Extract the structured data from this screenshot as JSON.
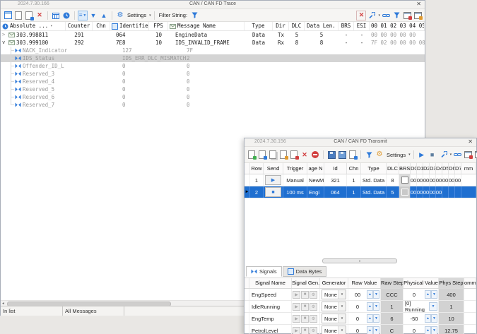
{
  "colors": {
    "accent": "#2f7ad9",
    "selection_blue": "#1f6fd0",
    "danger_red": "#d23f3f",
    "selected_gray": "#d4d4d4"
  },
  "icons": {
    "close": "✕",
    "play": "▶",
    "stop": "■",
    "up": "▲",
    "down": "▼",
    "caret": "▾",
    "gear": "⚙",
    "delete": "✕",
    "left_arrow": "◄",
    "row_marker": "►",
    "list": "≡"
  },
  "trace": {
    "version": "2024.7.30.166",
    "title": "CAN / CAN FD Trace",
    "toolbar": {
      "settings": "Settings",
      "filter_label": "Filter String:"
    },
    "columns": [
      "Absolute ...",
      "Counter",
      "Chn",
      "Identifier",
      "FPS",
      "Message Name",
      "Type",
      "Dir",
      "DLC",
      "Data Len.",
      "BRS",
      "ESI",
      "00 01 02 03 04 05"
    ],
    "rows": [
      {
        "expand": ">",
        "time": "303.998811",
        "counter": "291",
        "chn": "",
        "id": "064",
        "fps": "10",
        "name": "EngineData",
        "type": "Data",
        "dir": "Tx",
        "dlc": "5",
        "len": "5",
        "brs": "-",
        "esi": "-",
        "bytes": "00 00 00 00 00"
      },
      {
        "expand": "v",
        "time": "303.999100",
        "counter": "292",
        "chn": "",
        "id": "7E8",
        "fps": "10",
        "name": "IDS_INVALID_FRAME",
        "type": "Data",
        "dir": "Rx",
        "dlc": "8",
        "len": "8",
        "brs": "-",
        "esi": "-",
        "bytes": "7F 02 00 00 00 00"
      }
    ],
    "signals": [
      {
        "name": "NACK_Indicator",
        "value": "127",
        "raw": "7F"
      },
      {
        "name": "IDS_Status",
        "value": "IDS_ERR_DLC_MISMATCH",
        "raw": "2"
      },
      {
        "name": "Offender_ID_L",
        "value": "0",
        "raw": "0"
      },
      {
        "name": "Reserved_3",
        "value": "0",
        "raw": "0"
      },
      {
        "name": "Reserved_4",
        "value": "0",
        "raw": "0"
      },
      {
        "name": "Reserved_5",
        "value": "0",
        "raw": "0"
      },
      {
        "name": "Reserved_6",
        "value": "0",
        "raw": "0"
      },
      {
        "name": "Reserved_7",
        "value": "0",
        "raw": "0"
      }
    ],
    "status": [
      "In list",
      "All Messages",
      ""
    ]
  },
  "transmit": {
    "version": "2024.7.30.156",
    "title": "CAN / CAN FD Transmit",
    "toolbar": {
      "settings": "Settings"
    },
    "columns": [
      "Row",
      "Send",
      "Trigger",
      "age N",
      "Id",
      "Chn",
      "Type",
      "DLC",
      "BRS",
      "D0",
      "D1",
      "D2",
      "D3",
      "D4",
      "D5",
      "D6",
      "D7",
      "mm"
    ],
    "rows": [
      {
        "num": "1",
        "trigger": "Manual",
        "msg": "NewM",
        "id": "321",
        "chn": "1",
        "type": "Std. Data",
        "dlc": "8",
        "bytes": [
          "00",
          "00",
          "00",
          "00",
          "00",
          "00",
          "00",
          "00"
        ],
        "comment": ""
      },
      {
        "num": "2",
        "trigger": "100 ms",
        "msg": "Engi",
        "id": "064",
        "chn": "1",
        "type": "Std. Data",
        "dlc": "5",
        "bytes": [
          "00",
          "00",
          "00",
          "00",
          "00",
          "",
          "",
          ""
        ],
        "comment": ""
      }
    ],
    "tabs": [
      {
        "label": "Signals"
      },
      {
        "label": "Data Bytes"
      }
    ],
    "signal_columns": [
      "Signal Name",
      "Signal Gen.",
      "Generator",
      "Raw Value",
      "Raw Step",
      "Physical Value",
      "Phys Step",
      "omme"
    ],
    "signal_rows": [
      {
        "name": "EngSpeed",
        "generator": "None",
        "raw": "00",
        "raw_step": "CCC",
        "phys": "0",
        "phys_step": "400"
      },
      {
        "name": "IdleRunning",
        "generator": "None",
        "raw": "0",
        "raw_step": "1",
        "phys": "[0] Running",
        "phys_step": "1"
      },
      {
        "name": "EngTemp",
        "generator": "None",
        "raw": "0",
        "raw_step": "6",
        "phys": "-50",
        "phys_step": "10"
      },
      {
        "name": "PetrolLevel",
        "generator": "None",
        "raw": "0",
        "raw_step": "C",
        "phys": "0",
        "phys_step": "12.75"
      }
    ]
  }
}
